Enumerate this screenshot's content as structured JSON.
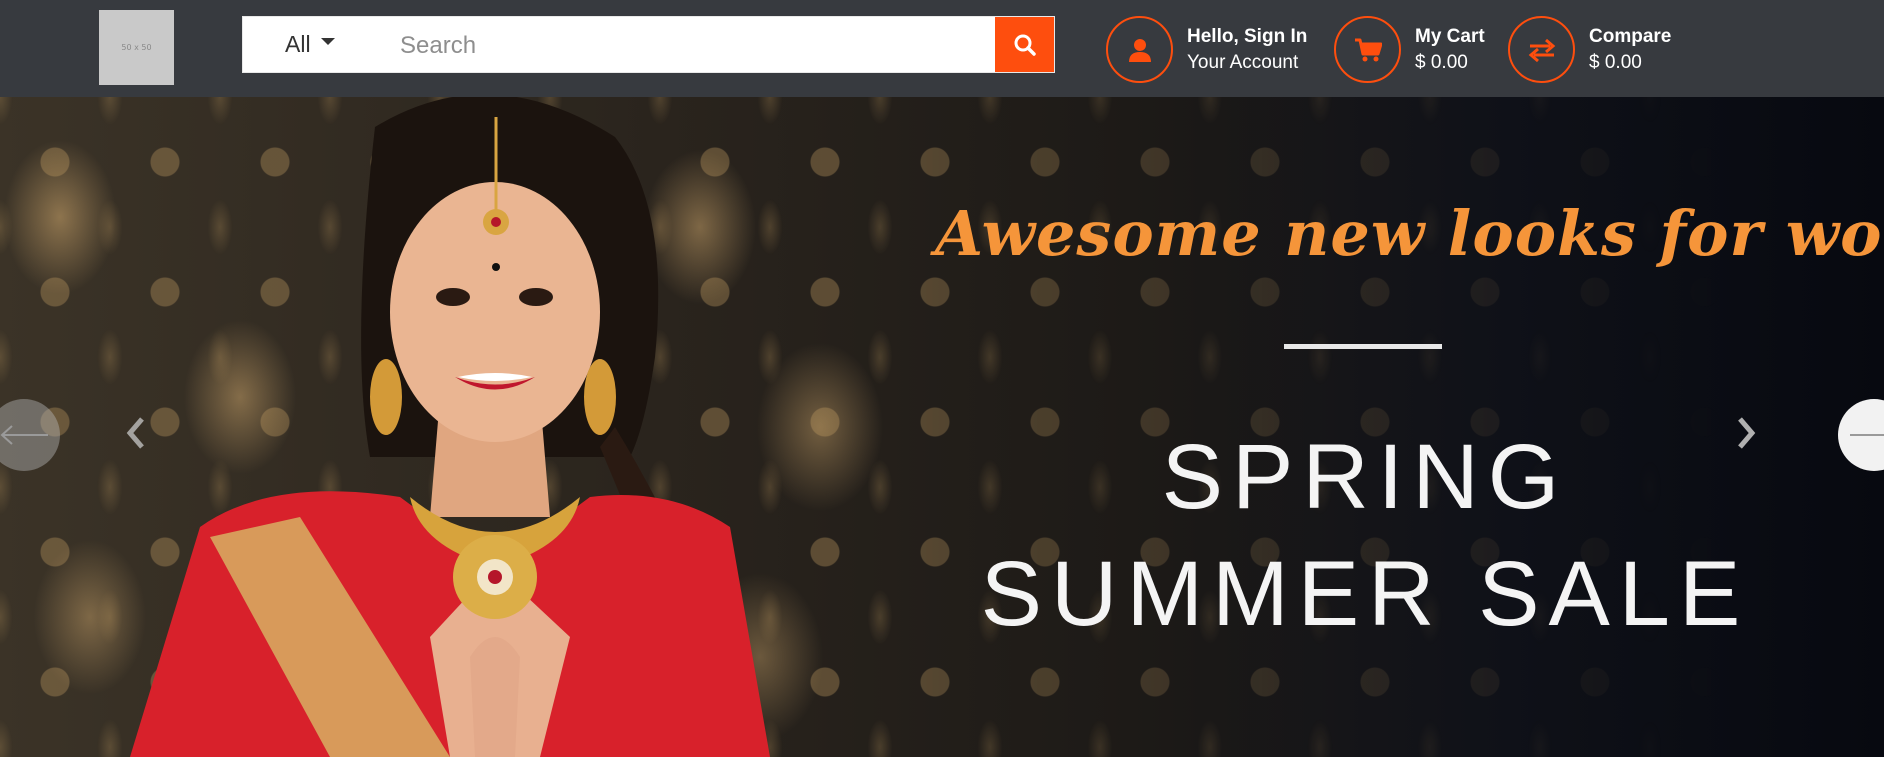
{
  "header": {
    "logo_text": "50 x 50",
    "search": {
      "category": "All",
      "placeholder": "Search"
    },
    "account": {
      "line1": "Hello, Sign In",
      "line2": "Your Account",
      "icon": "user-icon"
    },
    "cart": {
      "line1": "My Cart",
      "line2": "$ 0.00",
      "icon": "cart-icon"
    },
    "compare": {
      "line1": "Compare",
      "line2": "$ 0.00",
      "icon": "compare-arrows-icon"
    }
  },
  "banner": {
    "headline": "Awesome new looks for women",
    "sale_line1": "SPRING",
    "sale_line2": "SUMMER SALE"
  },
  "colors": {
    "accent": "#fe4e0e",
    "header_bg": "#373a3f",
    "headline": "#f5953a"
  }
}
